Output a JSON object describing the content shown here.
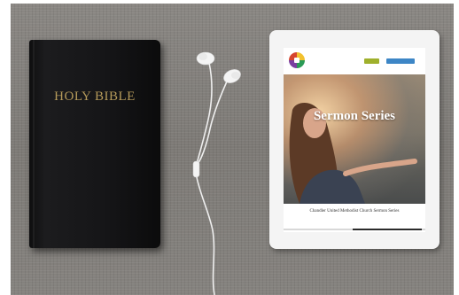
{
  "scene": {
    "bible": {
      "cover_text": "HOLY BIBLE",
      "cover_color": "#151517",
      "text_color": "#b59a5a"
    },
    "earphones": {
      "color": "#f2f2f2"
    },
    "tablet": {
      "site": {
        "logo_icon": "church-cross-logo-icon",
        "nav_buttons": [
          "",
          ""
        ],
        "hero_title": "Sermon Series",
        "caption": "Chandler United Methodist Church Sermon Series",
        "accent_green": "#9fb02c",
        "accent_blue": "#3d86c6"
      }
    }
  }
}
